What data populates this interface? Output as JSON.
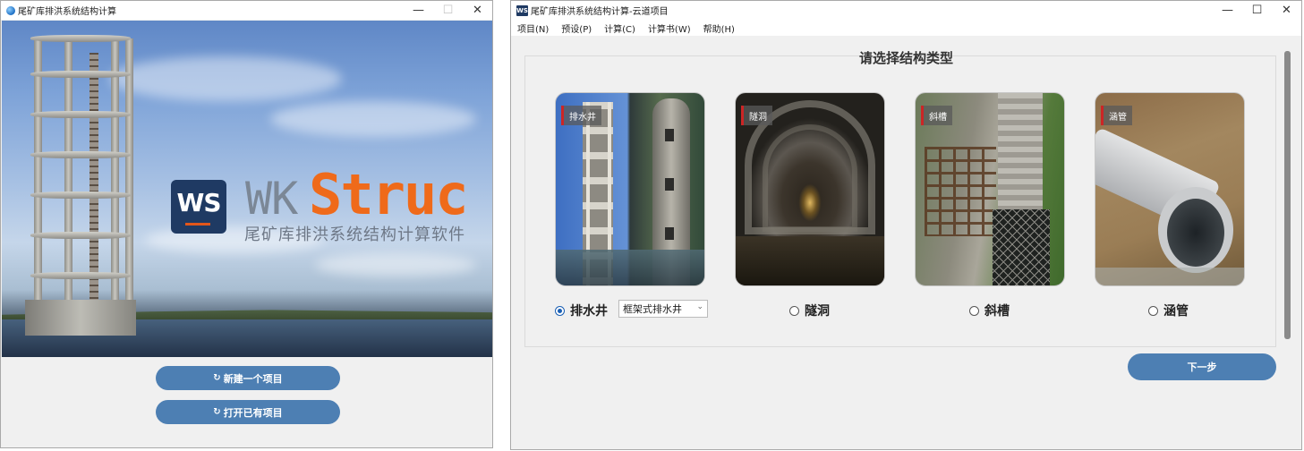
{
  "left_window": {
    "title": "尾矿库排洪系统结构计算",
    "controls": {
      "minimize": "—",
      "maximize": "☐",
      "close": "✕"
    },
    "splash": {
      "logo_text": "WS",
      "brand_prefix": "WK",
      "brand_suffix": "Struc",
      "subtitle": "尾矿库排洪系统结构计算软件"
    },
    "buttons": {
      "new_project": "新建一个项目",
      "open_project": "打开已有项目"
    },
    "colors": {
      "brand_orange": "#ef6a1a",
      "logo_navy": "#1f3a63",
      "button_blue": "#4d7fb3"
    }
  },
  "right_window": {
    "title": "尾矿库排洪系统结构计算-云道项目",
    "app_icon_text": "WS",
    "controls": {
      "minimize": "—",
      "maximize": "☐",
      "close": "✕"
    },
    "menu": [
      "项目(N)",
      "预设(P)",
      "计算(C)",
      "计算书(W)",
      "帮助(H)"
    ],
    "heading": "请选择结构类型",
    "options": [
      {
        "label": "排水井",
        "selected": true
      },
      {
        "label": "隧洞",
        "selected": false
      },
      {
        "label": "斜槽",
        "selected": false
      },
      {
        "label": "涵管",
        "selected": false
      }
    ],
    "drain_well_type": {
      "value": "框架式排水井",
      "chevron": "⌄"
    },
    "next_button": "下一步"
  }
}
